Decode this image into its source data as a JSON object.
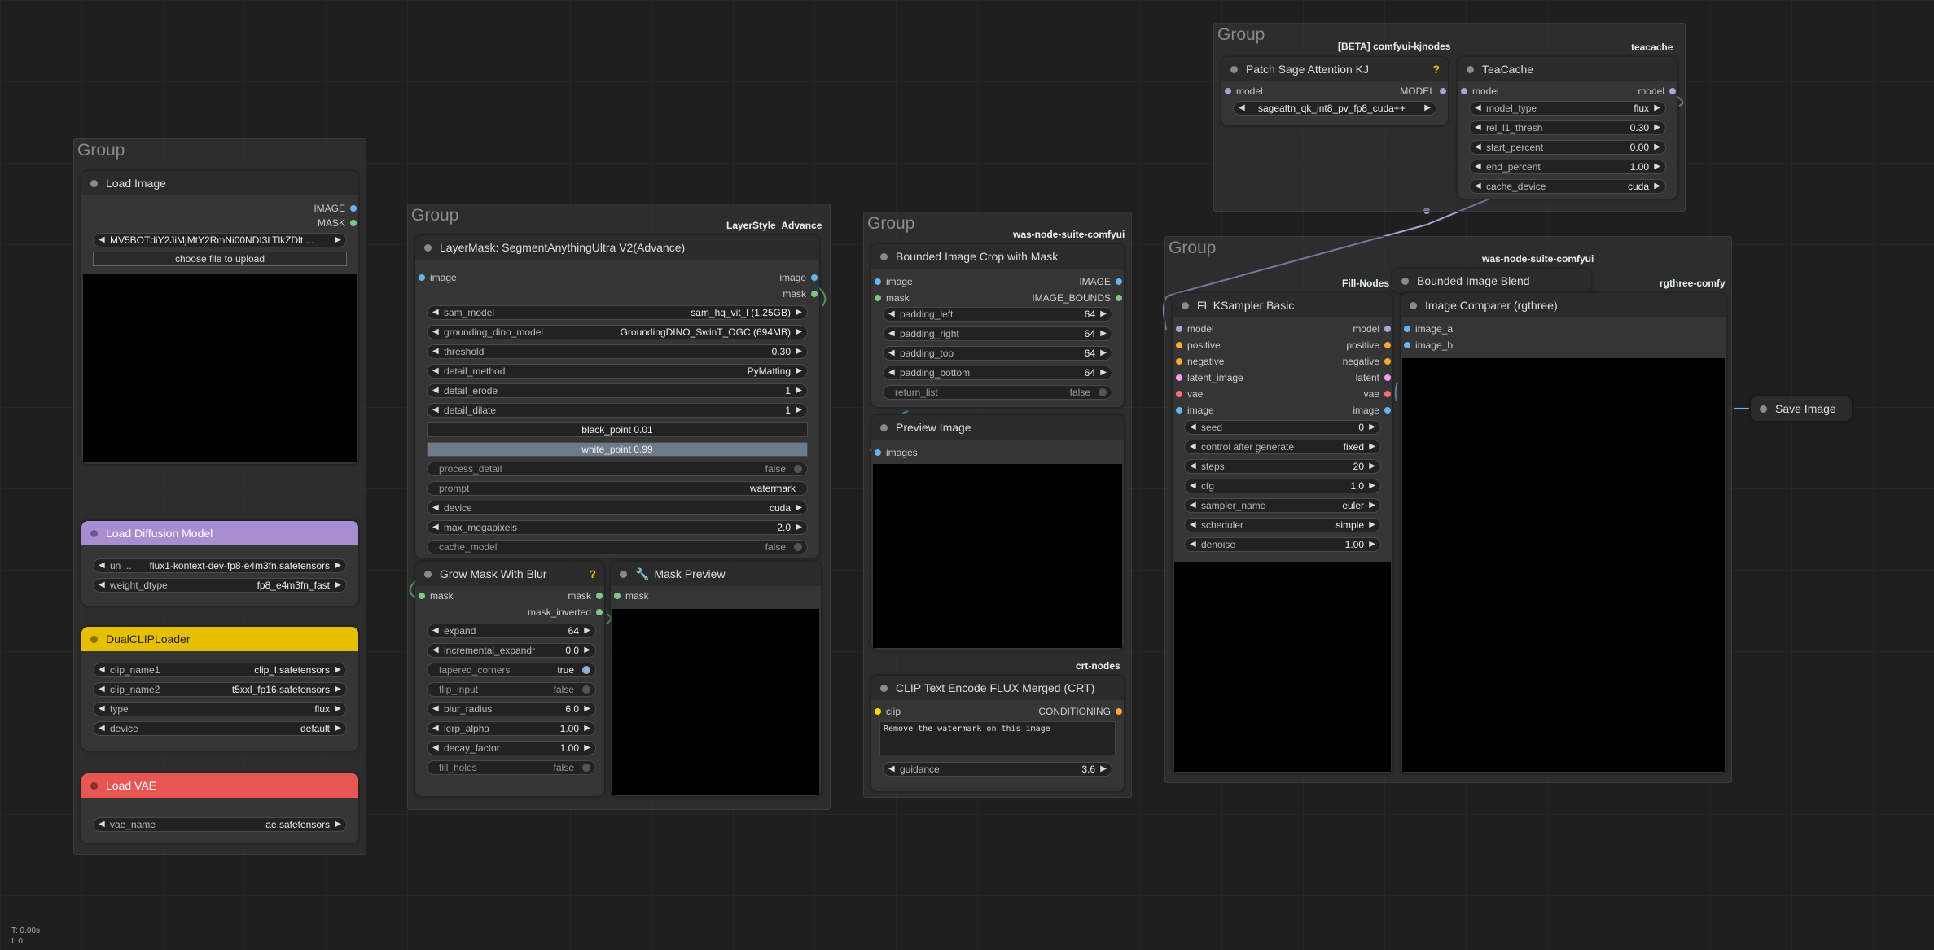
{
  "status": {
    "time": "T: 0.00s",
    "count": "I: 0"
  },
  "groups": {
    "g1": "Group",
    "g2": "Group",
    "g3": "Group",
    "g4": "Group",
    "g5": "Group"
  },
  "badges": {
    "layerstyle": "LayerStyle_Advance",
    "was1": "was-node-suite-comfyui",
    "was2": "was-node-suite-comfyui",
    "kjnodes": "[BETA] comfyui-kjnodes",
    "teacache": "teacache",
    "crt": "crt-nodes",
    "fill": "Fill-Nodes",
    "rgthree": "rgthree-comfy"
  },
  "load_image": {
    "title": "Load Image",
    "out_image": "IMAGE",
    "out_mask": "MASK",
    "file": "MV5BOTdiY2JiMjMtY2RmNi00NDI3LTlkZDlt ...",
    "upload": "choose file to upload"
  },
  "load_diffusion": {
    "title": "Load Diffusion Model",
    "unet_label": "un ...",
    "unet_value": "flux1-kontext-dev-fp8-e4m3fn.safetensors",
    "dtype_label": "weight_dtype",
    "dtype_value": "fp8_e4m3fn_fast"
  },
  "dualclip": {
    "title": "DualCLIPLoader",
    "w": [
      {
        "label": "clip_name1",
        "value": "clip_l.safetensors"
      },
      {
        "label": "clip_name2",
        "value": "t5xxl_fp16.safetensors"
      },
      {
        "label": "type",
        "value": "flux"
      },
      {
        "label": "device",
        "value": "default"
      }
    ]
  },
  "load_vae": {
    "title": "Load VAE",
    "label": "vae_name",
    "value": "ae.safetensors"
  },
  "segment": {
    "title": "LayerMask: SegmentAnythingUltra V2(Advance)",
    "in_image": "image",
    "out_image": "image",
    "out_mask": "mask",
    "w": [
      {
        "label": "sam_model",
        "value": "sam_hq_vit_l (1.25GB)"
      },
      {
        "label": "grounding_dino_model",
        "value": "GroundingDINO_SwinT_OGC (694MB)"
      },
      {
        "label": "threshold",
        "value": "0.30"
      },
      {
        "label": "detail_method",
        "value": "PyMatting"
      },
      {
        "label": "detail_erode",
        "value": "1"
      },
      {
        "label": "detail_dilate",
        "value": "1"
      }
    ],
    "black_point": "black_point  0.01",
    "white_point": "white_point  0.99",
    "process_detail": {
      "label": "process_detail",
      "value": "false"
    },
    "prompt": {
      "label": "prompt",
      "value": "watermark"
    },
    "device": {
      "label": "device",
      "value": "cuda"
    },
    "max_megapixels": {
      "label": "max_megapixels",
      "value": "2.0"
    },
    "cache_model": {
      "label": "cache_model",
      "value": "false"
    }
  },
  "grow_mask": {
    "title": "Grow Mask With Blur",
    "in_mask": "mask",
    "out_mask": "mask",
    "out_mask_inverted": "mask_inverted",
    "w": [
      {
        "label": "expand",
        "value": "64"
      },
      {
        "label": "incremental_expandr",
        "value": "0.0"
      }
    ],
    "tapered": {
      "label": "tapered_corners",
      "value": "true"
    },
    "flip": {
      "label": "flip_input",
      "value": "false"
    },
    "w2": [
      {
        "label": "blur_radius",
        "value": "6.0"
      },
      {
        "label": "lerp_alpha",
        "value": "1.00"
      },
      {
        "label": "decay_factor",
        "value": "1.00"
      }
    ],
    "fill_holes": {
      "label": "fill_holes",
      "value": "false"
    }
  },
  "mask_preview": {
    "title": "Mask Preview",
    "in_mask": "mask"
  },
  "bounded_crop": {
    "title": "Bounded Image Crop with Mask",
    "in_image": "image",
    "in_mask": "mask",
    "out_image": "IMAGE",
    "out_bounds": "IMAGE_BOUNDS",
    "w": [
      {
        "label": "padding_left",
        "value": "64"
      },
      {
        "label": "padding_right",
        "value": "64"
      },
      {
        "label": "padding_top",
        "value": "64"
      },
      {
        "label": "padding_bottom",
        "value": "64"
      }
    ],
    "return_list": {
      "label": "return_list",
      "value": "false"
    }
  },
  "preview_image": {
    "title": "Preview Image",
    "in_images": "images"
  },
  "clip_text": {
    "title": "CLIP Text Encode FLUX Merged (CRT)",
    "in_clip": "clip",
    "out_cond": "CONDITIONING",
    "text": "Remove the watermark on this image",
    "guidance_label": "guidance",
    "guidance_value": "3.6"
  },
  "patch_sage": {
    "title": "Patch Sage Attention KJ",
    "in_model": "model",
    "out_model": "MODEL",
    "value": "sageattn_qk_int8_pv_fp8_cuda++"
  },
  "teacache_node": {
    "title": "TeaCache",
    "in_model": "model",
    "out_model": "model",
    "w": [
      {
        "label": "model_type",
        "value": "flux"
      },
      {
        "label": "rel_l1_thresh",
        "value": "0.30"
      },
      {
        "label": "start_percent",
        "value": "0.00"
      },
      {
        "label": "end_percent",
        "value": "1.00"
      },
      {
        "label": "cache_device",
        "value": "cuda"
      }
    ]
  },
  "ksampler": {
    "title": "FL KSampler Basic",
    "ports": [
      {
        "in": "model",
        "out": "model",
        "color": "#b39ddb"
      },
      {
        "in": "positive",
        "out": "positive",
        "color": "#ffa931"
      },
      {
        "in": "negative",
        "out": "negative",
        "color": "#ffa931"
      },
      {
        "in": "latent_image",
        "out": "latent",
        "color": "#ff9cf9"
      },
      {
        "in": "vae",
        "out": "vae",
        "color": "#ff6e6e"
      },
      {
        "in": "image",
        "out": "image",
        "color": "#64b5f6"
      }
    ],
    "w": [
      {
        "label": "seed",
        "value": "0"
      },
      {
        "label": "control after generate",
        "value": "fixed"
      },
      {
        "label": "steps",
        "value": "20"
      },
      {
        "label": "cfg",
        "value": "1.0"
      },
      {
        "label": "sampler_name",
        "value": "euler"
      },
      {
        "label": "scheduler",
        "value": "simple"
      },
      {
        "label": "denoise",
        "value": "1.00"
      }
    ]
  },
  "bounded_blend": {
    "title": "Bounded Image Blend"
  },
  "image_comparer": {
    "title": "Image Comparer (rgthree)",
    "in_a": "image_a",
    "in_b": "image_b"
  },
  "save_image": {
    "title": "Save Image"
  }
}
